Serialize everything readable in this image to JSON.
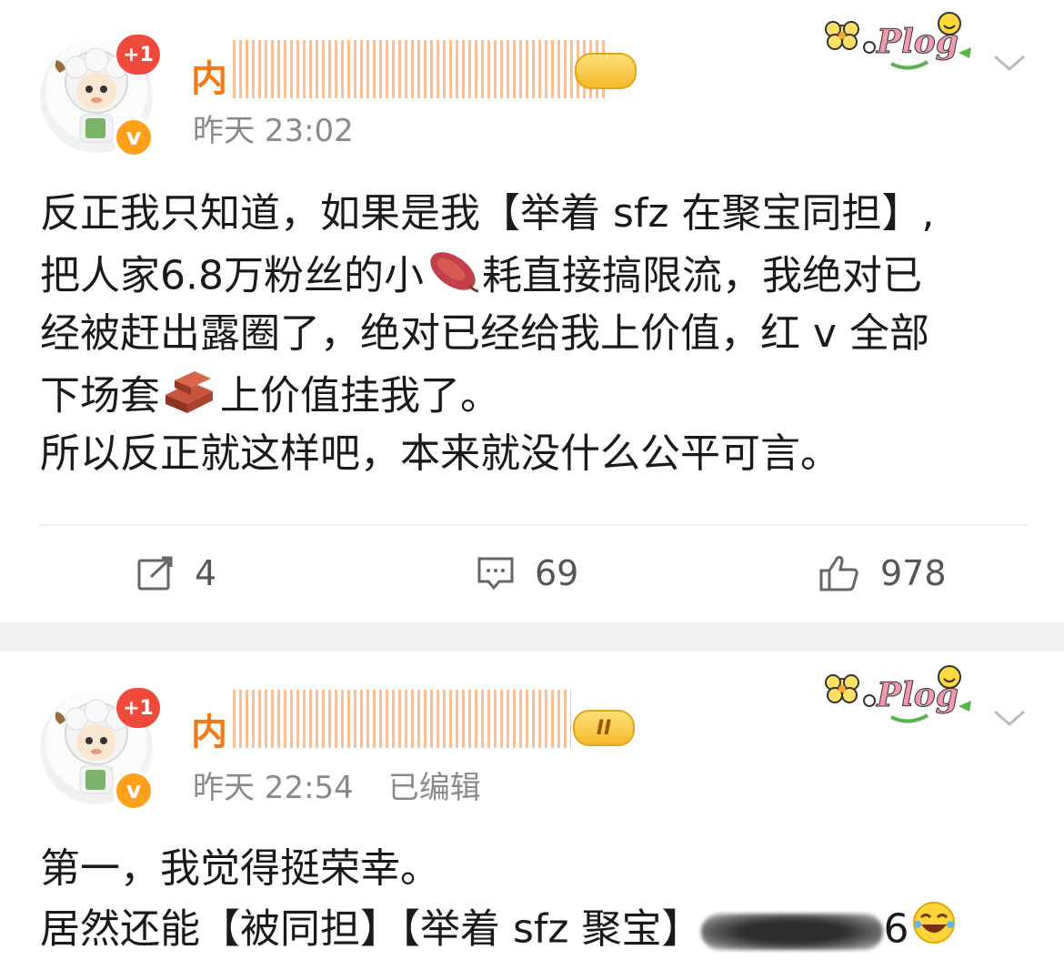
{
  "posts": [
    {
      "username_visible": "内",
      "plus_badge": "+1",
      "verified_mark": "v",
      "level_badge": "",
      "time": "昨天 23:02",
      "edited": "",
      "content_lines": [
        [
          "反正我只知道，如果是我【举着 sfz 在聚宝同担】,"
        ],
        [
          "把人家6.8万粉丝的小",
          "耗直接搞限流，我绝对已"
        ],
        [
          "经被赶出露圈了，绝对已经给我上价值，红 v 全部"
        ],
        [
          "下场套",
          "上价值挂我了。"
        ],
        [
          "所以反正就这样吧，本来就没什么公平可言。"
        ]
      ],
      "actions": {
        "repost": "4",
        "comment": "69",
        "like": "978"
      }
    },
    {
      "username_visible": "内",
      "plus_badge": "+1",
      "verified_mark": "v",
      "level_badge": "II",
      "time": "昨天 22:54",
      "edited": "已编辑",
      "content_lines": [
        [
          "第一，我觉得挺荣幸。"
        ],
        [
          "居然还能【被同担】【举着 sfz 聚宝】",
          "6"
        ]
      ]
    }
  ],
  "icons": {
    "sticker": "plog-flower-sticker",
    "more": "chevron-down-icon",
    "repost": "repost-icon",
    "comment": "comment-icon",
    "like": "thumbs-up-icon",
    "sweet_potato": "sweet-potato-emoji",
    "bricks": "bricks-emoji",
    "laugh": "laughing-emoji"
  },
  "colors": {
    "username": "#f07b17",
    "meta": "#8a8a8a",
    "badge_red": "#f04a3c",
    "verified": "#ff9f1a",
    "separator": "#f1f1f1"
  }
}
